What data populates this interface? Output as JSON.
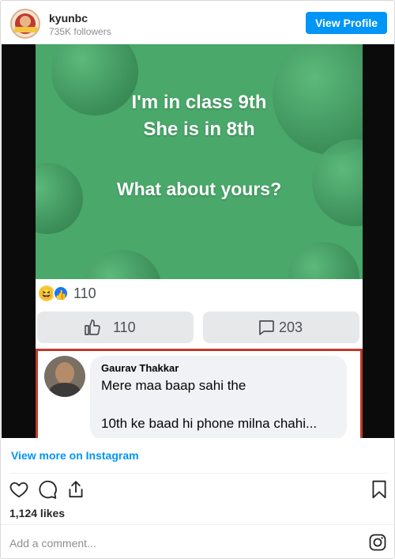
{
  "header": {
    "username": "kyunbc",
    "followers": "735K followers",
    "view_profile_label": "View Profile"
  },
  "post_image": {
    "meme_line1": "I'm in class 9th",
    "meme_line2": "She is in 8th",
    "meme_line3": "What about yours?",
    "reaction_count": "110",
    "like_count": "110",
    "comment_count": "203",
    "commenter_name": "Gaurav Thakkar",
    "comment_line1": "Mere maa baap sahi the",
    "comment_line2": "10th ke baad hi phone milna chahi...",
    "colors": {
      "green": "#49a86a",
      "border_red": "#c0392b",
      "fb_blue": "#1877f2"
    }
  },
  "footer": {
    "view_more_label": "View more on Instagram",
    "likes_text": "1,124 likes",
    "comment_placeholder": "Add a comment..."
  },
  "icons": [
    "heart-icon",
    "comment-icon",
    "share-icon",
    "bookmark-icon",
    "instagram-icon"
  ],
  "colors": {
    "accent": "#0095f6",
    "text": "#262626",
    "muted": "#8e8e8e"
  }
}
